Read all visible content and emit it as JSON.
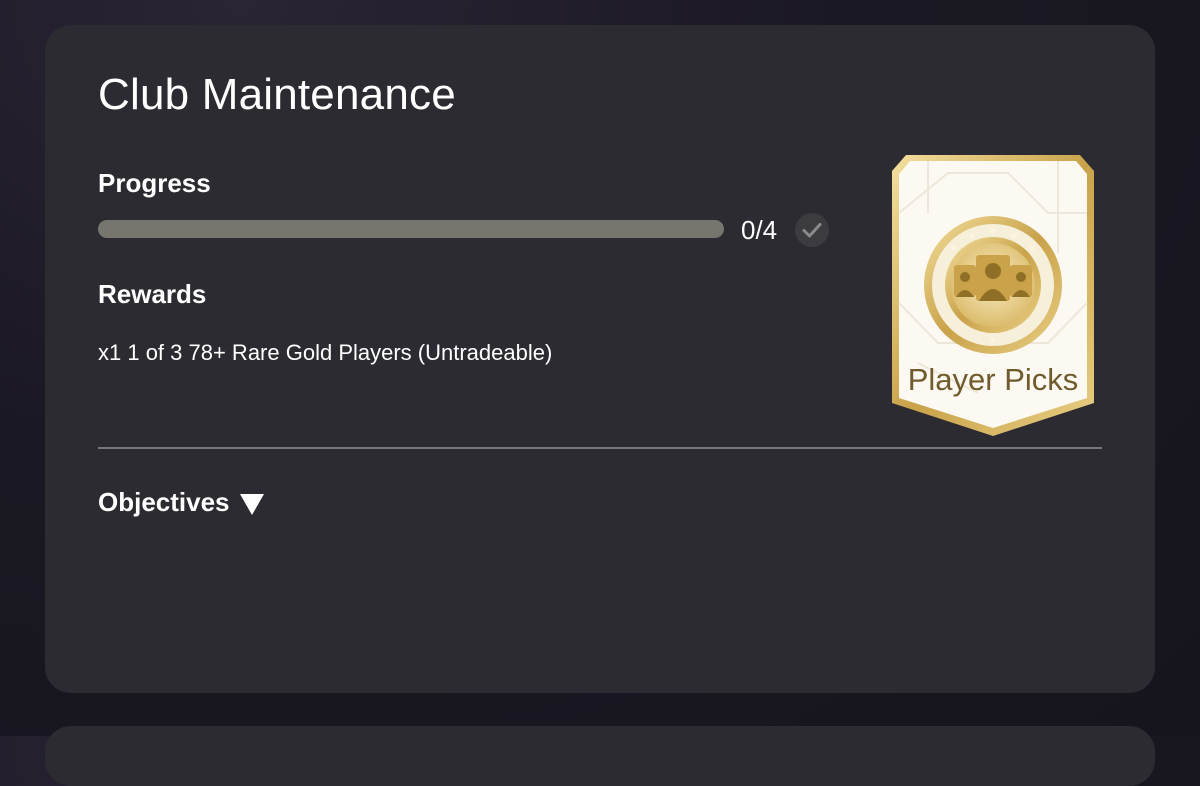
{
  "card": {
    "title": "Club Maintenance",
    "progress": {
      "label": "Progress",
      "count_text": "0/4",
      "completed": 0,
      "total": 4,
      "fraction": 0
    },
    "rewards": {
      "label": "Rewards",
      "item": "x1 1 of 3 78+ Rare Gold Players (Untradeable)",
      "pack_name": "Player Picks"
    },
    "objectives": {
      "label": "Objectives",
      "icon": "triangle-down-icon"
    }
  },
  "colors": {
    "card_bg": "#2c2b31",
    "track": "#76766f",
    "gold": "#d5b75d",
    "pack_text": "#6f5b2c"
  }
}
